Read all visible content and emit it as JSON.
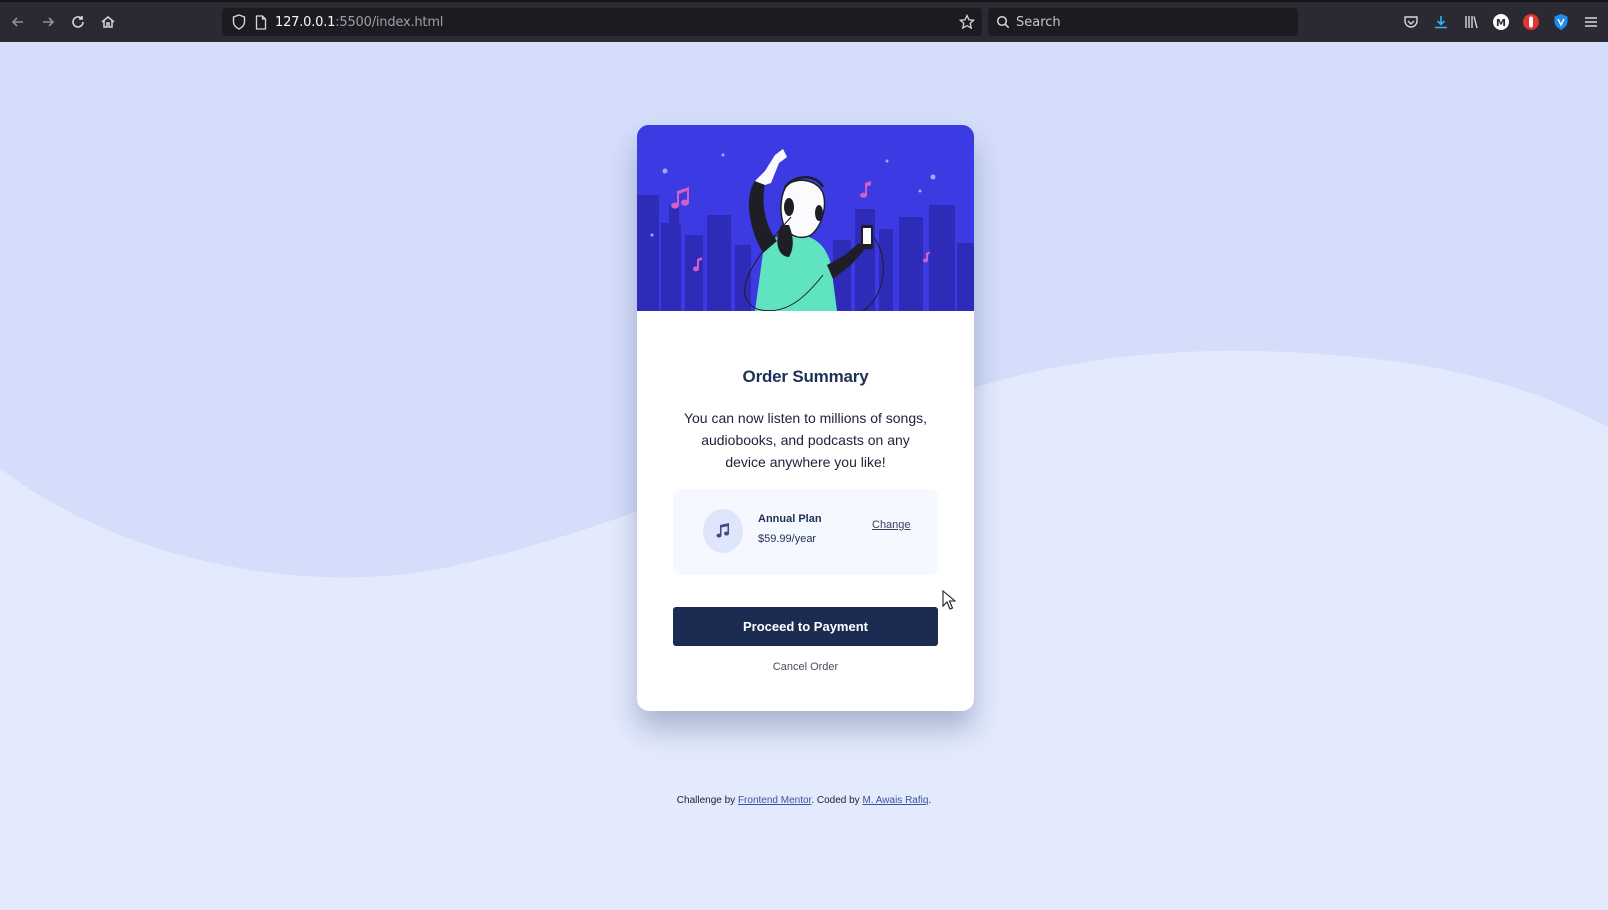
{
  "browser": {
    "url_host": "127.0.0.1",
    "url_path": ":5500/index.html",
    "search_placeholder": "Search",
    "icons": [
      "back-icon",
      "forward-icon",
      "reload-icon",
      "home-icon",
      "shield-icon",
      "page-icon",
      "bookmark-star-icon",
      "search-icon",
      "pocket-icon",
      "download-icon",
      "library-icon",
      "account-icon",
      "extension-icon",
      "vpn-icon",
      "menu-icon"
    ]
  },
  "card": {
    "title": "Order Summary",
    "description": "You can now listen to millions of songs, audiobooks, and podcasts on any device anywhere you like!",
    "plan": {
      "name": "Annual Plan",
      "price": "$59.99/year",
      "change_label": "Change",
      "icon": "music-note-icon"
    },
    "pay_label": "Proceed to Payment",
    "cancel_label": "Cancel Order"
  },
  "footer": {
    "prefix": "Challenge by",
    "link1": "Frontend Mentor",
    "middle": ". Coded by",
    "link2": "M. Awais Rafiq",
    "suffix": "."
  },
  "colors": {
    "background": "#e0e8fd",
    "wave": "#d1dcfa",
    "hero": "#3c3be3",
    "button": "#1c2b52",
    "plan_box": "#f5f8ff"
  }
}
